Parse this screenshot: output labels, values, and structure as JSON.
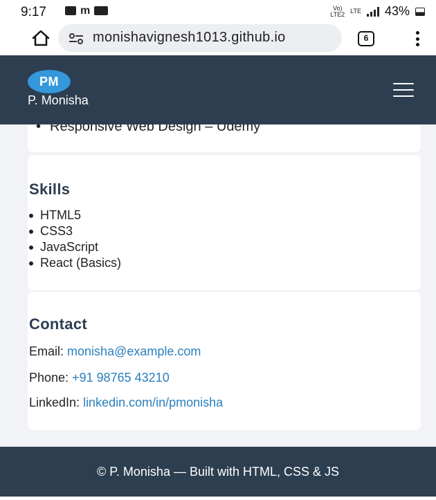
{
  "status_bar": {
    "time": "9:17",
    "volte_line1": "Vo)",
    "volte_line2": "LTE2",
    "lte": "LTE",
    "battery": "43%"
  },
  "browser": {
    "url": "monishavignesh1013.github.io",
    "tab_count": "6"
  },
  "header": {
    "logo_text": "PM",
    "site_name": "P. Monisha"
  },
  "certifications": {
    "visible_item": "Responsive Web Design – Udemy"
  },
  "skills": {
    "title": "Skills",
    "items": [
      "HTML5",
      "CSS3",
      "JavaScript",
      "React (Basics)"
    ]
  },
  "contact": {
    "title": "Contact",
    "email_label": "Email: ",
    "email_value": "monisha@example.com",
    "phone_label": "Phone: ",
    "phone_value": "+91 98765 43210",
    "linkedin_label": "LinkedIn: ",
    "linkedin_value": "linkedin.com/in/pmonisha"
  },
  "footer": {
    "text": "© P. Monisha — Built with HTML, CSS & JS"
  },
  "colors": {
    "header_bg": "#2c3e50",
    "accent": "#3498db",
    "link": "#2b7fbb",
    "page_bg": "#f1f3f6"
  }
}
